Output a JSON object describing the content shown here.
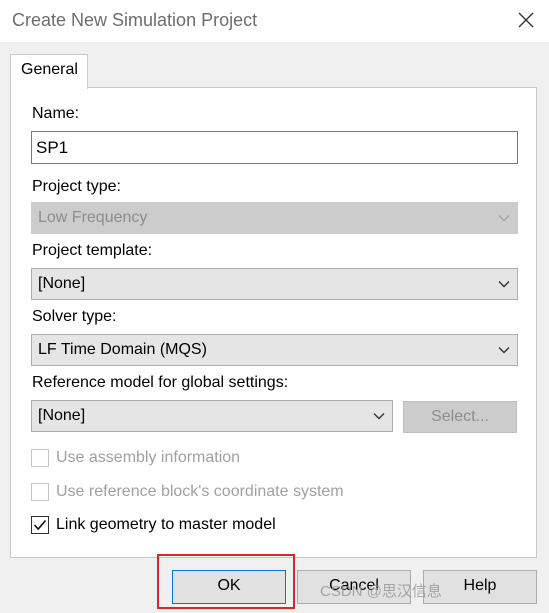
{
  "window": {
    "title": "Create New Simulation Project"
  },
  "tabs": [
    {
      "label": "General"
    }
  ],
  "fields": {
    "name_label": "Name:",
    "name_value": "SP1",
    "project_type_label": "Project type:",
    "project_type_value": "Low Frequency",
    "project_template_label": "Project template:",
    "project_template_value": "[None]",
    "solver_type_label": "Solver type:",
    "solver_type_value": "LF Time Domain (MQS)",
    "reference_model_label": "Reference model for global settings:",
    "reference_model_value": "[None]",
    "select_button_label": "Select..."
  },
  "checkboxes": [
    {
      "label": "Use assembly information",
      "checked": false,
      "enabled": false
    },
    {
      "label": "Use reference block's coordinate system",
      "checked": false,
      "enabled": false
    },
    {
      "label": "Link geometry to master model",
      "checked": true,
      "enabled": true
    }
  ],
  "buttons": {
    "ok": "OK",
    "cancel": "Cancel",
    "help": "Help"
  },
  "watermark": "CSDN @思汉信息",
  "colors": {
    "highlight": "#d62828",
    "dialog_bg": "#f0f0f0",
    "disabled_text": "#a0a0a0"
  }
}
